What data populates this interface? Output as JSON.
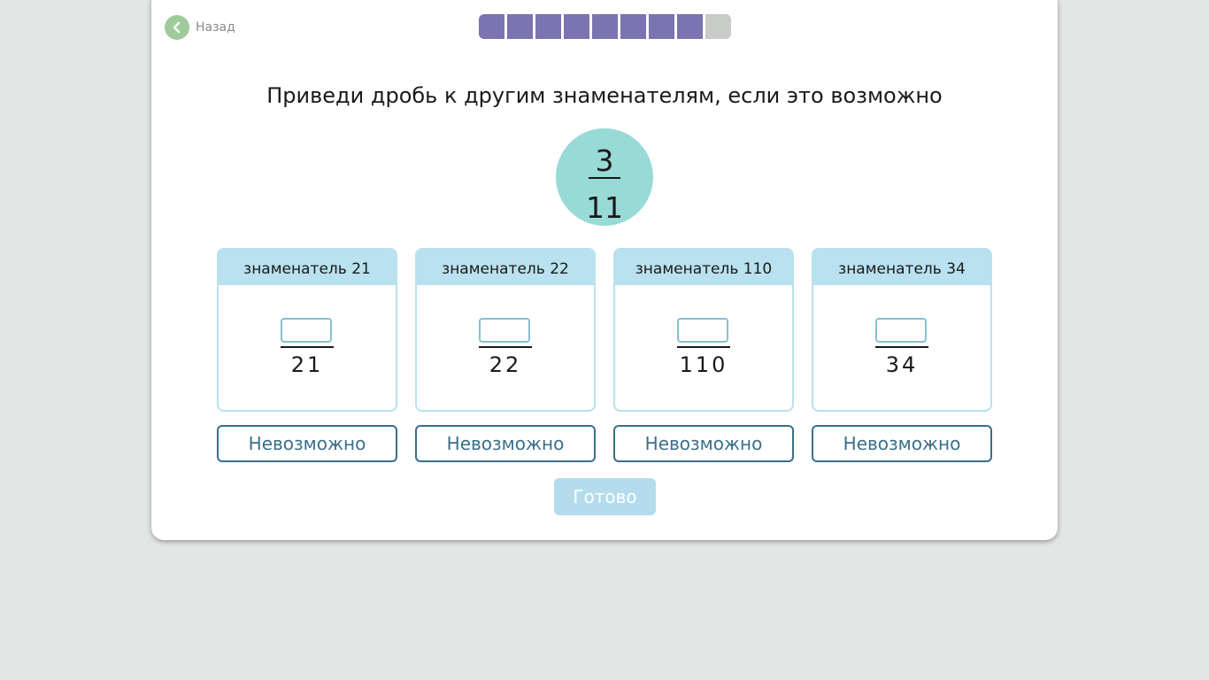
{
  "nav": {
    "back_label": "Назад"
  },
  "progress": {
    "completed": 8,
    "total": 9
  },
  "task": {
    "title": "Приведи дробь к другим знаменателям, если это возможно",
    "fraction": {
      "numerator": "3",
      "denominator": "11"
    }
  },
  "options": [
    {
      "header": "знаменатель 21",
      "denominator": "21",
      "numerator_value": "",
      "impossible_label": "Невозможно"
    },
    {
      "header": "знаменатель 22",
      "denominator": "22",
      "numerator_value": "",
      "impossible_label": "Невозможно"
    },
    {
      "header": "знаменатель 110",
      "denominator": "110",
      "numerator_value": "",
      "impossible_label": "Невозможно"
    },
    {
      "header": "знаменатель 34",
      "denominator": "34",
      "numerator_value": "",
      "impossible_label": "Невозможно"
    }
  ],
  "actions": {
    "done_label": "Готово"
  },
  "colors": {
    "progress_done": "#7b74b0",
    "progress_todo": "#c9cbc8",
    "fraction_circle": "#98dad6",
    "box_header": "#b9e1ef",
    "button_border": "#3a6f8a",
    "done_button": "#b4dcec",
    "back_button": "#9fcb9a"
  }
}
